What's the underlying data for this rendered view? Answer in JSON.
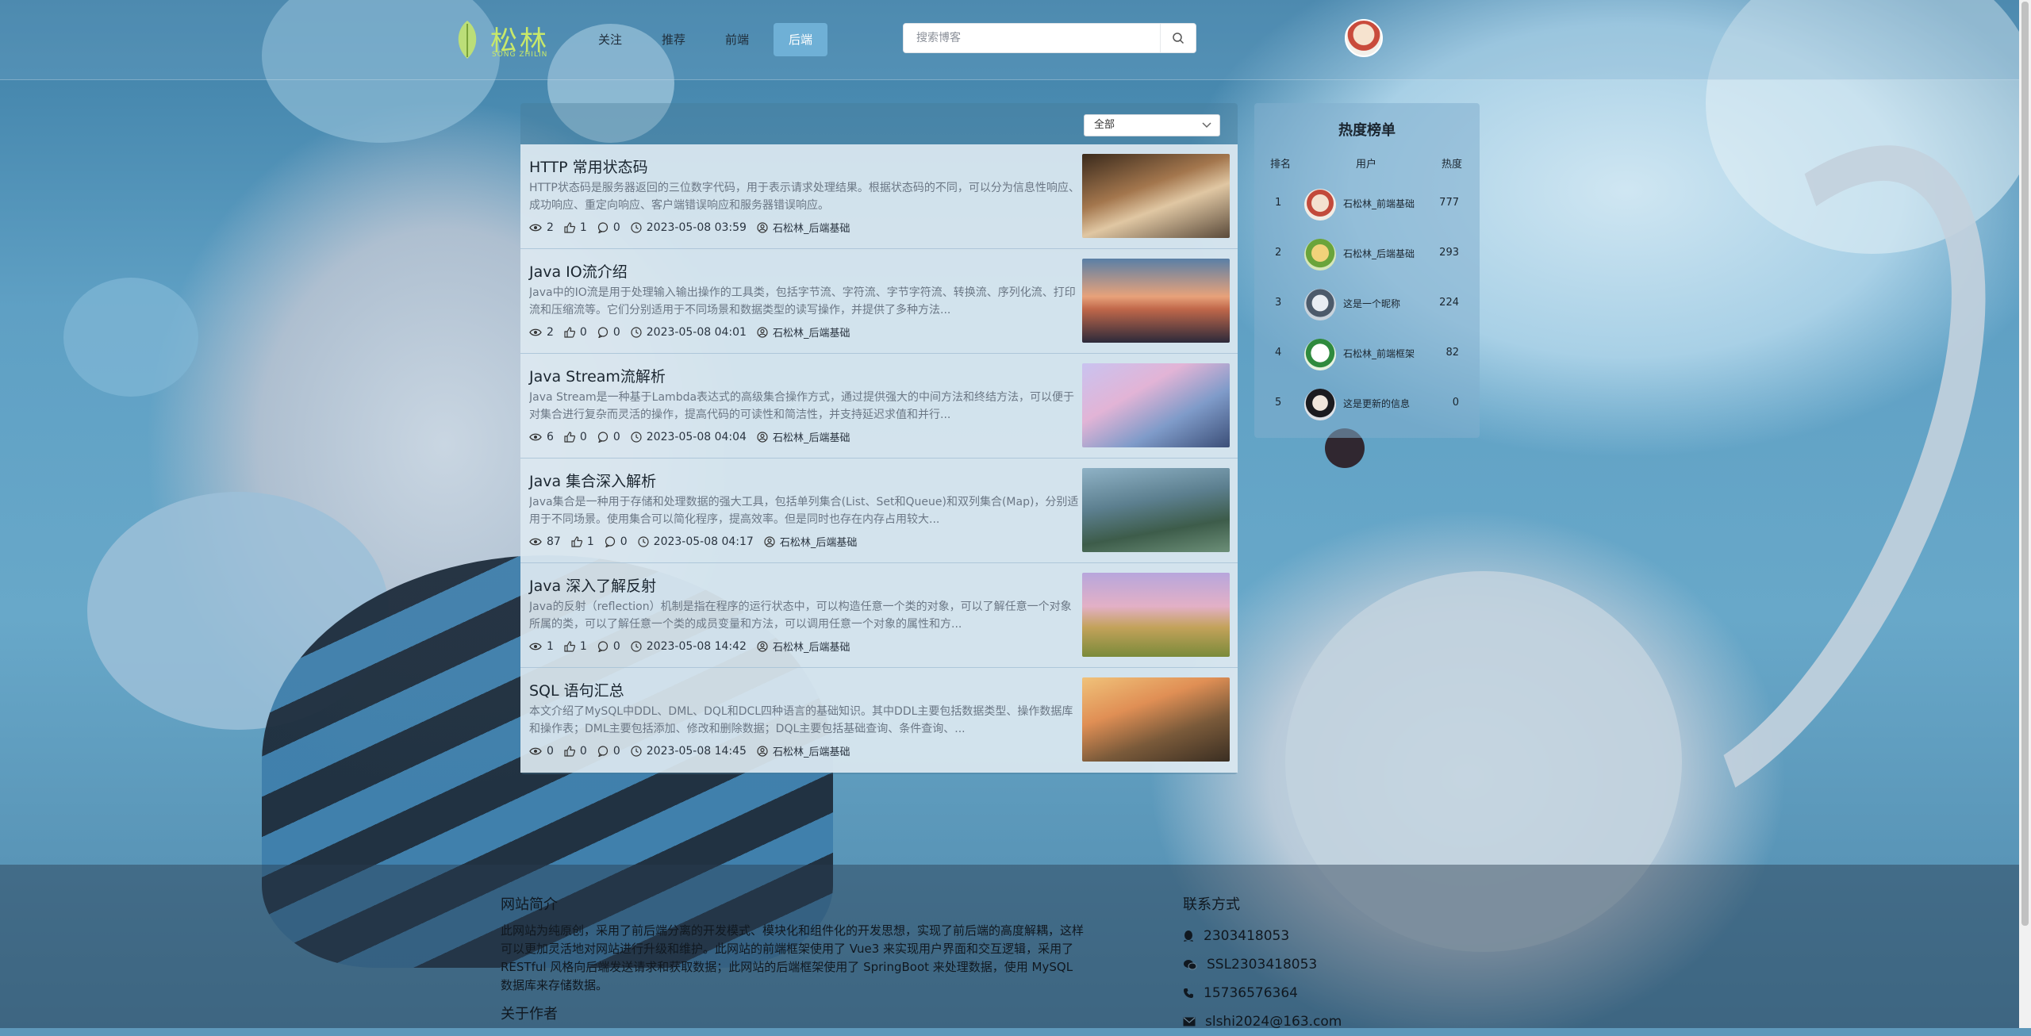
{
  "brand": {
    "logo_text": "松林",
    "logo_sub": "SONG ZHILIN"
  },
  "nav": {
    "items": [
      {
        "label": "关注",
        "active": false
      },
      {
        "label": "推荐",
        "active": false
      },
      {
        "label": "前端",
        "active": false
      },
      {
        "label": "后端",
        "active": true
      }
    ]
  },
  "search": {
    "placeholder": "搜索博客"
  },
  "filter": {
    "selected": "全部"
  },
  "articles": [
    {
      "title": "HTTP 常用状态码",
      "desc": "HTTP状态码是服务器返回的三位数字代码，用于表示请求处理结果。根据状态码的不同，可以分为信息性响应、成功响应、重定向响应、客户端错误响应和服务器错误响应。",
      "views": "2",
      "likes": "1",
      "comments": "0",
      "date": "2023-05-08 03:59",
      "author": "石松林_后端基础"
    },
    {
      "title": "Java IO流介绍",
      "desc": "Java中的IO流是用于处理输入输出操作的工具类，包括字节流、字符流、字节字符流、转换流、序列化流、打印流和压缩流等。它们分别适用于不同场景和数据类型的读写操作，并提供了多种方法...",
      "views": "2",
      "likes": "0",
      "comments": "0",
      "date": "2023-05-08 04:01",
      "author": "石松林_后端基础"
    },
    {
      "title": "Java Stream流解析",
      "desc": "Java Stream是一种基于Lambda表达式的高级集合操作方式，通过提供强大的中间方法和终结方法，可以便于对集合进行复杂而灵活的操作，提高代码的可读性和简洁性，并支持延迟求值和并行...",
      "views": "6",
      "likes": "0",
      "comments": "0",
      "date": "2023-05-08 04:04",
      "author": "石松林_后端基础"
    },
    {
      "title": "Java 集合深入解析",
      "desc": "Java集合是一种用于存储和处理数据的强大工具，包括单列集合(List、Set和Queue)和双列集合(Map)，分别适用于不同场景。使用集合可以简化程序，提高效率。但是同时也存在内存占用较大...",
      "views": "87",
      "likes": "1",
      "comments": "0",
      "date": "2023-05-08 04:17",
      "author": "石松林_后端基础"
    },
    {
      "title": "Java 深入了解反射",
      "desc": "Java的反射（reflection）机制是指在程序的运行状态中，可以构造任意一个类的对象，可以了解任意一个对象所属的类，可以了解任意一个类的成员变量和方法，可以调用任意一个对象的属性和方...",
      "views": "1",
      "likes": "1",
      "comments": "0",
      "date": "2023-05-08 14:42",
      "author": "石松林_后端基础"
    },
    {
      "title": "SQL 语句汇总",
      "desc": "本文介绍了MySQL中DDL、DML、DQL和DCL四种语言的基础知识。其中DDL主要包括数据类型、操作数据库和操作表；DML主要包括添加、修改和删除数据；DQL主要包括基础查询、条件查询、...",
      "views": "0",
      "likes": "0",
      "comments": "0",
      "date": "2023-05-08 14:45",
      "author": "石松林_后端基础"
    }
  ],
  "hot": {
    "title": "热度榜单",
    "headers": {
      "rank": "排名",
      "user": "用户",
      "score": "热度"
    },
    "rows": [
      {
        "rank": "1",
        "name": "石松林_前端基础",
        "score": "777"
      },
      {
        "rank": "2",
        "name": "石松林_后端基础",
        "score": "293"
      },
      {
        "rank": "3",
        "name": "这是一个昵称",
        "score": "224"
      },
      {
        "rank": "4",
        "name": "石松林_前端框架",
        "score": "82"
      },
      {
        "rank": "5",
        "name": "这是更新的信息",
        "score": "0"
      }
    ]
  },
  "footer": {
    "intro_title": "网站简介",
    "intro_text": "此网站为纯原创，采用了前后端分离的开发模式、模块化和组件化的开发思想，实现了前后端的高度解耦，这样可以更加灵活地对网站进行升级和维护。此网站的前端框架使用了 Vue3 来实现用户界面和交互逻辑，采用了 RESTful 风格向后端发送请求和获取数据；此网站的后端框架使用了 SpringBoot 来处理数据，使用 MySQL 数据库来存储数据。",
    "author_title": "关于作者",
    "contact_title": "联系方式",
    "qq": "2303418053",
    "wechat": "SSL2303418053",
    "phone": "15736576364",
    "email": "slshi2024@163.com"
  },
  "colors": {
    "nav_active": "#6fb0d6",
    "logo": "#c8e86a"
  }
}
